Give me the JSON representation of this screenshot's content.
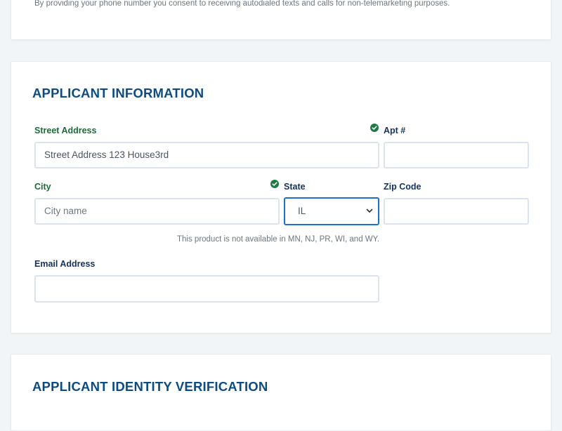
{
  "consent_text": "By providing your phone number you consent to receiving autodialed texts and calls for non-telemarketing purposes.",
  "applicant_section": {
    "title": "APPLICANT INFORMATION",
    "street": {
      "label": "Street Address",
      "value": "Street Address 123 House3rd",
      "valid": true
    },
    "apt": {
      "label": "Apt #",
      "value": ""
    },
    "city": {
      "label": "City",
      "placeholder": "City name",
      "valid": true
    },
    "state": {
      "label": "State",
      "value": "IL"
    },
    "zip": {
      "label": "Zip Code",
      "value": ""
    },
    "availability_notice": "This product is not available in MN, NJ, PR, WI, and WY.",
    "email": {
      "label": "Email Address",
      "value": ""
    }
  },
  "identity_section": {
    "title": "APPLICANT IDENTITY VERIFICATION"
  },
  "colors": {
    "title": "#0e4c80",
    "label": "#16325c",
    "valid_label": "#1e6b3a",
    "check": "#1e7a45",
    "focus_border": "#1c70c9",
    "input_border": "#dbe4ec"
  }
}
